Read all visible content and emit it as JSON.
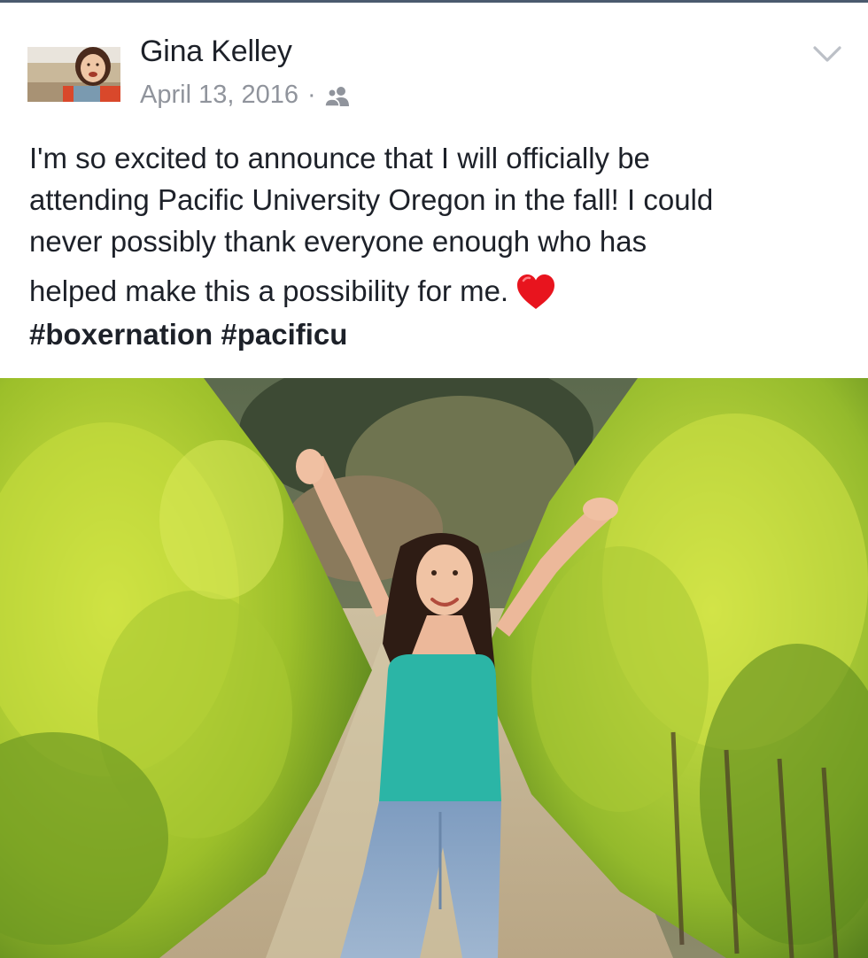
{
  "post": {
    "author_name": "Gina Kelley",
    "date": "April 13, 2016",
    "separator": "·",
    "audience_icon": "friends-icon",
    "menu_icon": "chevron-down-icon",
    "text_lines": [
      "I'm so excited to announce that I will officially be",
      "attending Pacific University Oregon in the fall! I could",
      "never possibly thank everyone enough who has",
      "helped make this a possibility for me."
    ],
    "emoji": "red-heart-icon",
    "hashtags": [
      "#boxernation",
      "#pacificu"
    ]
  },
  "colors": {
    "text": "#1d2129",
    "meta": "#90949c",
    "heart": "#e8141e",
    "shirt": "#2bb5a6"
  }
}
